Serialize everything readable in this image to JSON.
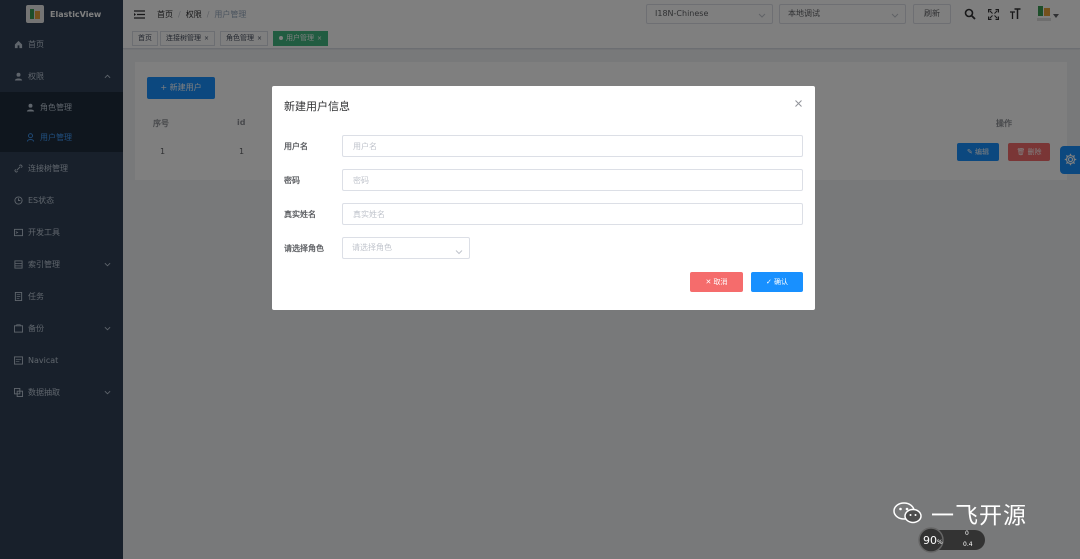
{
  "app": {
    "title": "ElasticView"
  },
  "sidebar": {
    "items": [
      {
        "label": "首页",
        "icon": "home-icon"
      },
      {
        "label": "权限",
        "icon": "user-icon",
        "expanded": true
      },
      {
        "label": "连接树管理",
        "icon": "link-icon"
      },
      {
        "label": "ES状态",
        "icon": "clock-icon"
      },
      {
        "label": "开发工具",
        "icon": "terminal-icon"
      },
      {
        "label": "索引管理",
        "icon": "index-icon",
        "has_children": true
      },
      {
        "label": "任务",
        "icon": "task-icon"
      },
      {
        "label": "备份",
        "icon": "backup-icon",
        "has_children": true
      },
      {
        "label": "Navicat",
        "icon": "navicat-icon"
      },
      {
        "label": "数据抽取",
        "icon": "extract-icon",
        "has_children": true
      }
    ],
    "sub_items": [
      {
        "label": "角色管理",
        "icon": "role-icon"
      },
      {
        "label": "用户管理",
        "icon": "user-manage-icon",
        "active": true
      }
    ]
  },
  "header": {
    "breadcrumb": [
      "首页",
      "权限",
      "用户管理"
    ],
    "language_select": "I18N-Chinese",
    "env_select": "本地调试",
    "refresh_label": "刷新"
  },
  "tags": [
    {
      "label": "首页"
    },
    {
      "label": "连接树管理"
    },
    {
      "label": "角色管理"
    },
    {
      "label": "用户管理",
      "active": true
    }
  ],
  "page": {
    "add_user_label": "新建用户",
    "columns": [
      "序号",
      "id",
      "操作"
    ],
    "rows": [
      {
        "index": "1",
        "id": "1"
      }
    ],
    "edit_label": "编辑",
    "delete_label": "删除"
  },
  "modal": {
    "title": "新建用户信息",
    "fields": {
      "username": {
        "label": "用户名",
        "placeholder": "用户名"
      },
      "password": {
        "label": "密码",
        "placeholder": "密码"
      },
      "realname": {
        "label": "真实姓名",
        "placeholder": "真实姓名"
      },
      "role": {
        "label": "请选择角色",
        "placeholder": "请选择角色"
      }
    },
    "cancel_label": "取消",
    "confirm_label": "确认"
  },
  "watermark": {
    "text": "一飞开源"
  },
  "system_badge": {
    "percent": "90",
    "unit": "%",
    "up": "0",
    "down": "0.4"
  },
  "colors": {
    "sidebar_bg": "#304156",
    "primary": "#1890ff",
    "danger": "#f56c6c",
    "tag_active": "#42b983"
  }
}
